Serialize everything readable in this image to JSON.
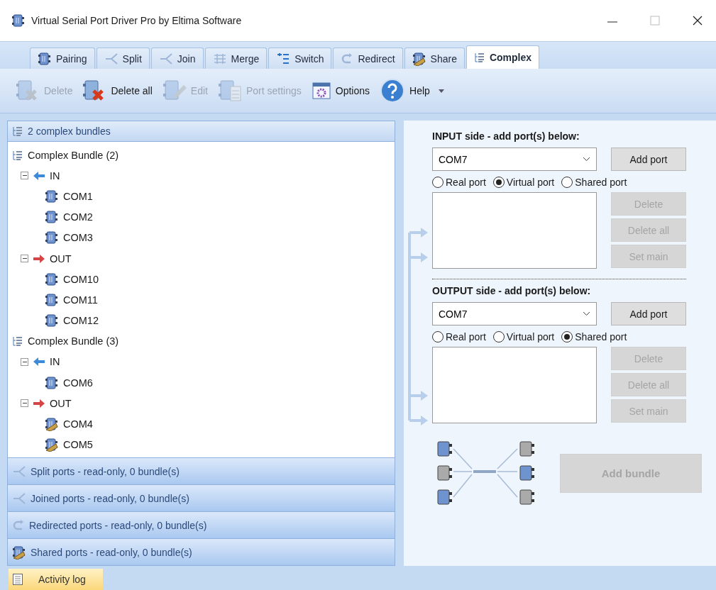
{
  "window": {
    "title": "Virtual Serial Port Driver Pro by Eltima Software"
  },
  "tabs": [
    {
      "label": "Pairing",
      "kind": "pairing",
      "selected": false
    },
    {
      "label": "Split",
      "kind": "split",
      "selected": false
    },
    {
      "label": "Join",
      "kind": "join",
      "selected": false
    },
    {
      "label": "Merge",
      "kind": "merge",
      "selected": false
    },
    {
      "label": "Switch",
      "kind": "switch",
      "selected": false
    },
    {
      "label": "Redirect",
      "kind": "redirect",
      "selected": false
    },
    {
      "label": "Share",
      "kind": "share",
      "selected": false
    },
    {
      "label": "Complex",
      "kind": "complex",
      "selected": true
    }
  ],
  "toolbar": [
    {
      "label": "Delete",
      "kind": "delete",
      "disabled": true,
      "menu": false
    },
    {
      "label": "Delete all",
      "kind": "delete-all",
      "disabled": false,
      "menu": false
    },
    {
      "label": "Edit",
      "kind": "edit",
      "disabled": true,
      "menu": false
    },
    {
      "label": "Port settings",
      "kind": "port-settings",
      "disabled": true,
      "menu": false
    },
    {
      "label": "Options",
      "kind": "options",
      "disabled": false,
      "menu": false
    },
    {
      "label": "Help",
      "kind": "help",
      "disabled": false,
      "menu": true
    }
  ],
  "left_panel": {
    "header": "2 complex bundles",
    "tree": [
      {
        "label": "Complex Bundle (2)",
        "kind": "bundle",
        "children": [
          {
            "label": "IN",
            "kind": "in",
            "expanded": true,
            "children": [
              {
                "label": "COM1",
                "kind": "virtual"
              },
              {
                "label": "COM2",
                "kind": "virtual"
              },
              {
                "label": "COM3",
                "kind": "virtual"
              }
            ]
          },
          {
            "label": "OUT",
            "kind": "out",
            "expanded": true,
            "children": [
              {
                "label": "COM10",
                "kind": "virtual"
              },
              {
                "label": "COM11",
                "kind": "virtual"
              },
              {
                "label": "COM12",
                "kind": "virtual"
              }
            ]
          }
        ]
      },
      {
        "label": "Complex Bundle (3)",
        "kind": "bundle",
        "children": [
          {
            "label": "IN",
            "kind": "in",
            "expanded": true,
            "children": [
              {
                "label": "COM6",
                "kind": "virtual"
              }
            ]
          },
          {
            "label": "OUT",
            "kind": "out",
            "expanded": true,
            "children": [
              {
                "label": "COM4",
                "kind": "shared"
              },
              {
                "label": "COM5",
                "kind": "shared"
              }
            ]
          }
        ]
      }
    ],
    "sections": [
      {
        "label": "Split ports - read-only, 0 bundle(s)",
        "kind": "split"
      },
      {
        "label": "Joined ports - read-only, 0 bundle(s)",
        "kind": "join"
      },
      {
        "label": "Redirected ports - read-only, 0 bundle(s)",
        "kind": "redirect"
      },
      {
        "label": "Shared ports - read-only, 0 bundle(s)",
        "kind": "share"
      }
    ]
  },
  "right_panel": {
    "sides": [
      {
        "title": "INPUT side - add port(s) below:",
        "port": "COM7",
        "add_button": "Add port",
        "radios": [
          {
            "label": "Real port",
            "selected": false
          },
          {
            "label": "Virtual port",
            "selected": true
          },
          {
            "label": "Shared port",
            "selected": false
          }
        ],
        "list_buttons": [
          {
            "label": "Delete",
            "disabled": true
          },
          {
            "label": "Delete all",
            "disabled": true
          },
          {
            "label": "Set main",
            "disabled": true
          }
        ]
      },
      {
        "title": "OUTPUT side - add port(s) below:",
        "port": "COM7",
        "add_button": "Add port",
        "radios": [
          {
            "label": "Real port",
            "selected": false
          },
          {
            "label": "Virtual port",
            "selected": false
          },
          {
            "label": "Shared port",
            "selected": true
          }
        ],
        "list_buttons": [
          {
            "label": "Delete",
            "disabled": true
          },
          {
            "label": "Delete all",
            "disabled": true
          },
          {
            "label": "Set main",
            "disabled": true
          }
        ]
      }
    ],
    "add_bundle": {
      "label": "Add bundle",
      "disabled": true
    }
  },
  "status_bar": {
    "tabs": [
      {
        "label": "Activity log",
        "selected": true
      }
    ]
  }
}
